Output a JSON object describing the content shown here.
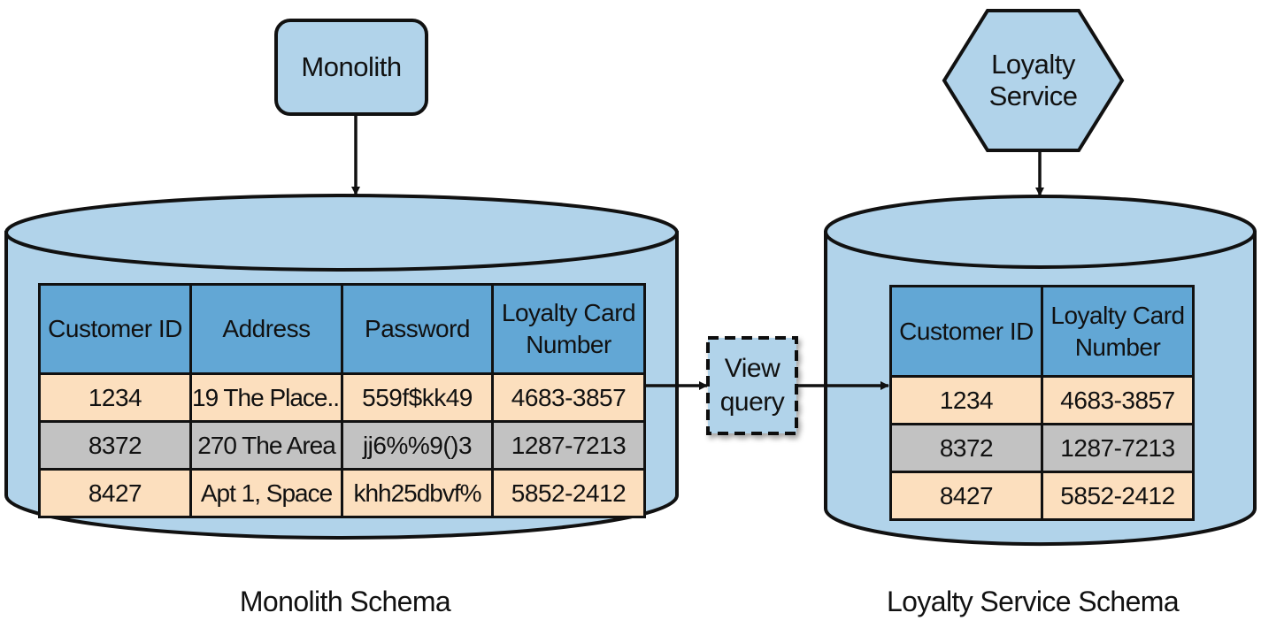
{
  "colors": {
    "node_fill": "#b1d3ea",
    "header_fill": "#62a7d5",
    "row_peach": "#fcdfbe",
    "row_gray": "#c2c2c2",
    "stroke": "#111111"
  },
  "monolith_node": {
    "label": "Monolith",
    "shape": "rounded-rectangle"
  },
  "loyalty_service_node": {
    "label_line1": "Loyalty",
    "label_line2": "Service",
    "shape": "hexagon"
  },
  "view_query_node": {
    "label_line1": "View",
    "label_line2": "query",
    "shape": "dashed-rectangle"
  },
  "monolith_schema": {
    "label": "Monolith Schema",
    "table": {
      "headers": [
        "Customer ID",
        "Address",
        "Password",
        "Loyalty Card\nNumber"
      ],
      "header_lines": [
        [
          "Customer ID"
        ],
        [
          "Address"
        ],
        [
          "Password"
        ],
        [
          "Loyalty Card",
          "Number"
        ]
      ],
      "rows": [
        [
          "1234",
          "19 The Place...",
          "559f$kk49",
          "4683-3857"
        ],
        [
          "8372",
          "270 The Area",
          "jj6%%9()3",
          "1287-7213"
        ],
        [
          "8427",
          "Apt 1, Space",
          "khh25dbvf%",
          "5852-2412"
        ]
      ]
    }
  },
  "loyalty_service_schema": {
    "label": "Loyalty Service Schema",
    "table": {
      "headers": [
        "Customer ID",
        "Loyalty Card\nNumber"
      ],
      "header_lines": [
        [
          "Customer ID"
        ],
        [
          "Loyalty Card",
          "Number"
        ]
      ],
      "rows": [
        [
          "1234",
          "4683-3857"
        ],
        [
          "8372",
          "1287-7213"
        ],
        [
          "8427",
          "5852-2412"
        ]
      ]
    }
  },
  "edges": [
    {
      "from": "Monolith",
      "to": "Monolith Schema",
      "style": "solid-arrow"
    },
    {
      "from": "Loyalty Service",
      "to": "Loyalty Service Schema",
      "style": "solid-arrow"
    },
    {
      "from": "Monolith Schema",
      "to": "View query",
      "style": "solid-arrow"
    },
    {
      "from": "View query",
      "to": "Loyalty Service Schema",
      "style": "solid-arrow"
    }
  ]
}
